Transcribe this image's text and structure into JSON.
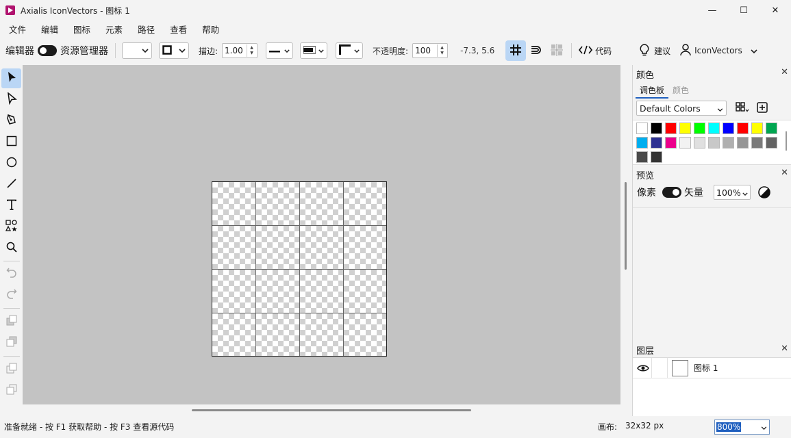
{
  "window": {
    "title": "Axialis IconVectors - 图标 1",
    "minimize": "—",
    "maximize": "☐",
    "close": "✕"
  },
  "menu": [
    "文件",
    "编辑",
    "图标",
    "元素",
    "路径",
    "查看",
    "帮助"
  ],
  "toolbar": {
    "mode_left": "编辑器",
    "mode_right": "资源管理器",
    "stroke_label": "描边:",
    "stroke_width": "1.00",
    "opacity_label": "不透明度:",
    "opacity_value": "100",
    "coords": "-7.3, 5.6",
    "code_label": "代码",
    "suggest_label": "建议",
    "user_name": "IconVectors"
  },
  "panels": {
    "colors": {
      "title": "颜色",
      "tabs": [
        "调色板",
        "颜色"
      ],
      "active_tab": "调色板",
      "palette_name": "Default Colors",
      "swatches": [
        "#ffffff",
        "#000000",
        "#ff0000",
        "#ffff00",
        "#00ff00",
        "#00ffff",
        "#0000ff",
        "#ff0000",
        "#ffff00",
        "#00a651",
        "#00aeef",
        "#2e3192",
        "#ec008c",
        "#f2f2f2",
        "#e0e0e0",
        "#c8c8c8",
        "#b0b0b0",
        "#969696",
        "#7a7a7a",
        "#636363",
        "#4a4a4a",
        "#333333"
      ]
    },
    "preview": {
      "title": "预览",
      "left_label": "像素",
      "right_label": "矢量",
      "zoom": "100%"
    },
    "layers": {
      "title": "图层",
      "items": [
        "图标 1"
      ]
    }
  },
  "status": {
    "help_text": "准备就绪 - 按 F1 获取帮助 - 按 F3 查看源代码",
    "canvas_label": "画布:",
    "canvas_size": "32x32 px",
    "zoom": "800%"
  },
  "colors": {
    "accent": "#1f5fbf",
    "active_tool_bg": "#bad6f5",
    "canvas_bg": "#c3c3c3"
  }
}
